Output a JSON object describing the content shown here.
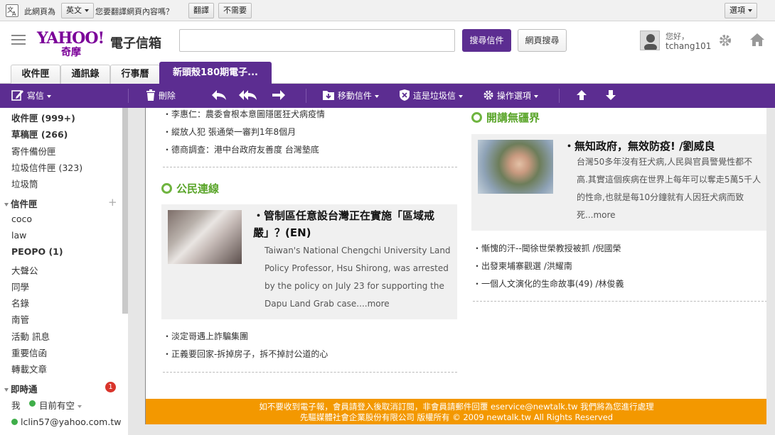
{
  "translate_bar": {
    "prefix": "此網頁為",
    "language": "英文",
    "question": "您要翻譯網頁內容嗎？",
    "translate_label": "翻譯",
    "decline_label": "不需要",
    "options_label": "選項"
  },
  "header": {
    "logo_text": "YAHOO!",
    "logo_sub": "奇摩",
    "app_name": "電子信箱",
    "search_mail_label": "搜尋信件",
    "web_search_label": "網頁搜尋",
    "greeting": "您好，",
    "username": "tchang101"
  },
  "tabs": [
    {
      "label": "收件匣"
    },
    {
      "label": "通訊錄"
    },
    {
      "label": "行事曆"
    },
    {
      "label": "新頭殼180期電子..."
    }
  ],
  "toolbar": {
    "compose": "寫信",
    "delete": "刪除",
    "move": "移動信件",
    "spam": "這是垃圾信",
    "actions": "操作選項"
  },
  "sidebar": {
    "folders": [
      {
        "label": "收件匣 (999+)",
        "bold": true
      },
      {
        "label": "草稿匣 (266)",
        "bold": true
      },
      {
        "label": "寄件備份匣",
        "bold": false
      },
      {
        "label": "垃圾信件匣 (323)",
        "bold": false
      },
      {
        "label": "垃圾筒",
        "bold": false
      }
    ],
    "mailbox_header": "信件匣",
    "mailboxes": [
      {
        "label": "coco",
        "bold": false
      },
      {
        "label": "law",
        "bold": false
      },
      {
        "label": "PEOPO (1)",
        "bold": true
      },
      {
        "label": "大聲公",
        "bold": false
      },
      {
        "label": "同學",
        "bold": false
      },
      {
        "label": "名錄",
        "bold": false
      },
      {
        "label": "南管",
        "bold": false
      },
      {
        "label": "活動 訊息",
        "bold": false
      },
      {
        "label": "重要信函",
        "bold": false
      },
      {
        "label": "轉載文章",
        "bold": false
      }
    ],
    "im_header": "即時通",
    "im_badge": "1",
    "me_label": "我",
    "status_label": "目前有空",
    "contact": "lclin57@yahoo.com.tw"
  },
  "mail": {
    "top_links": [
      "・李惠仁：農委會根本意圖隱匿狂犬病疫情",
      "・縱放人犯 張通榮一審判1年8個月",
      "・德商調查：港中台政府友善度 台灣墊底"
    ],
    "civic_title": "公民連線",
    "civic_headline": "・管制區任意設台灣正在實施「區域戒嚴」？(EN)",
    "civic_body": "Taiwan's National Chengchi University Land Policy Professor, Hsu Shirong, was arrested by the policy on July 23 for supporting the Dapu Land Grab case....more",
    "civic_links": [
      "・淡定哥遇上詐騙集團",
      "・正義要回家-拆掉房子，拆不掉討公道的心"
    ],
    "opinion_title": "開講無疆界",
    "opinion_headline": "・無知政府，無效防疫! /劉威良",
    "opinion_body": "台灣50多年沒有狂犬病,人民與官員警覺性都不高.其實這個疾病在世界上每年可以奪走5萬5千人的性命,也就是每10分鐘就有人因狂犬病而致死...more",
    "opinion_links": [
      "・慚愧的汗--聞徐世榮教授被抓 /倪國榮",
      "・出發柬埔寨觀選 /洪耀南",
      "・一個人文演化的生命故事(49) /林俊義"
    ],
    "footer_line1": "如不要收到電子報，會員請登入後取消訂閱，非會員請郵件回覆 eservice@newtalk.tw 我們將為您進行處理",
    "footer_line2": "先驅媒體社會企業股份有限公司 版權所有 © 2009 newtalk.tw All Rights Reserved"
  }
}
